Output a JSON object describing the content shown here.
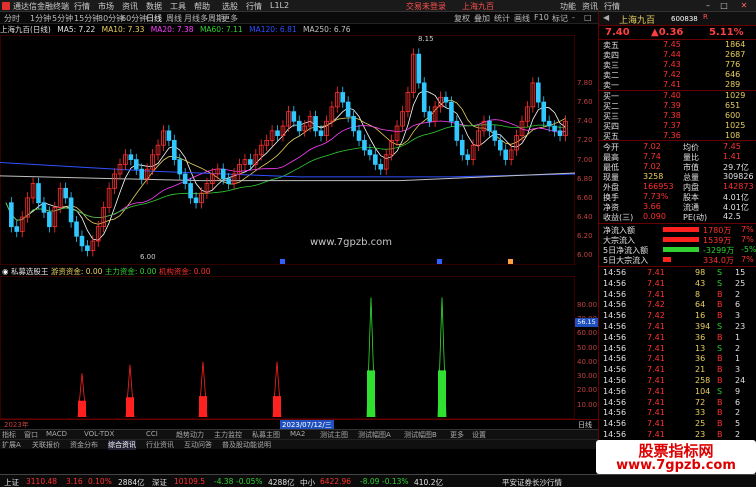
{
  "window": {
    "app_title": "通达信金融终端",
    "menus": [
      "行情",
      "市场",
      "资讯",
      "数据",
      "工具",
      "帮助",
      "选股",
      "行情",
      "L1L2"
    ],
    "center_notice": "交易未登录",
    "center_stock": "上海九百",
    "right_links": [
      "功能",
      "资讯",
      "行情"
    ]
  },
  "period_bar": {
    "periods": [
      "分时",
      "1分钟",
      "5分钟",
      "15分钟",
      "30分钟",
      "60分钟",
      "日线",
      "周线",
      "月线",
      "多周期",
      "更多"
    ],
    "active": "日线",
    "tools": [
      "复权",
      "叠加",
      "统计",
      "画线",
      "F10",
      "标记",
      "-",
      "□"
    ]
  },
  "info_line": {
    "title": "上海九百(日线)",
    "ma5": "MA5: 7.22",
    "ma10": "MA10: 7.33",
    "ma20": "MA20: 7.38",
    "ma60": "MA60: 7.11",
    "ma120": "MA120: 6.81",
    "ma250": "MA250: 6.76"
  },
  "main_chart": {
    "high_label": "8.15",
    "low_label": "6.00",
    "site_watermark": "www.7gpzb.com",
    "price_ticks": [
      "7.80",
      "7.60",
      "7.40",
      "7.20",
      "7.00",
      "6.80",
      "6.60",
      "6.40",
      "6.20",
      "6.00"
    ],
    "price_range": [
      5.9,
      8.3
    ],
    "colors": {
      "up": "#ff3030",
      "down": "#30c8ff",
      "ma5": "#ffffff",
      "ma10": "#e8d060",
      "ma20": "#ff40ff",
      "ma60": "#30d030",
      "ma120": "#3050ff",
      "ma250": "#c0c0c0"
    }
  },
  "indicator": {
    "name": "私募选股王",
    "fund_main": "游资资金: 0.00",
    "fund_force": "主力资金: 0.00",
    "fund_inst": "机构资金: 0.00",
    "ticks": [
      "80.00",
      "70.00",
      "60.00",
      "50.00",
      "40.00",
      "30.00",
      "20.00",
      "10.00"
    ],
    "marker_value": "56.15",
    "range": [
      0,
      100
    ]
  },
  "chart_data": {
    "type": "candlestick",
    "title": "上海九百(日线)",
    "ylim": [
      6.0,
      8.2
    ],
    "annotations": [
      {
        "label": "8.15",
        "kind": "high"
      },
      {
        "label": "6.00",
        "kind": "low"
      }
    ],
    "indicator_spikes": [
      {
        "index": 1,
        "value": 32,
        "color": "red"
      },
      {
        "index": 2,
        "value": 38,
        "color": "red"
      },
      {
        "index": 3,
        "value": 40,
        "color": "red"
      },
      {
        "index": 4,
        "value": 40,
        "color": "red"
      },
      {
        "index": 5,
        "value": 85,
        "color": "green"
      },
      {
        "index": 6,
        "value": 85,
        "color": "green"
      }
    ]
  },
  "date_axis": {
    "left_label": "2023年",
    "cursor_date": "2023/07/12/三",
    "right_label": "日线"
  },
  "tabs_row1": [
    "指标",
    "窗口",
    "MACD",
    "VOL-TDX",
    "CCI",
    "趋势动力",
    "主力监控",
    "私募主图",
    "MA2",
    "测试主图",
    "测试幅图A",
    "测试幅图B",
    "更多",
    "设置"
  ],
  "tabs_row2": [
    "扩展A",
    "关联报价",
    "资金分布",
    "综合资讯",
    "行业资讯",
    "互动问答",
    "普及股动能说明"
  ],
  "right_panel": {
    "name": "上海九百",
    "code": "600838",
    "flag": "R",
    "price": "7.40",
    "change": "▲0.36",
    "pct": "5.11%",
    "asks": [
      {
        "label": "卖五",
        "price": "7.45",
        "vol": "1864"
      },
      {
        "label": "卖四",
        "price": "7.44",
        "vol": "2687"
      },
      {
        "label": "卖三",
        "price": "7.43",
        "vol": "776"
      },
      {
        "label": "卖二",
        "price": "7.42",
        "vol": "646"
      },
      {
        "label": "卖一",
        "price": "7.41",
        "vol": "289"
      }
    ],
    "bids": [
      {
        "label": "买一",
        "price": "7.40",
        "vol": "1029"
      },
      {
        "label": "买二",
        "price": "7.39",
        "vol": "651"
      },
      {
        "label": "买三",
        "price": "7.38",
        "vol": "600"
      },
      {
        "label": "买四",
        "price": "7.37",
        "vol": "1025"
      },
      {
        "label": "买五",
        "price": "7.36",
        "vol": "108"
      }
    ],
    "stats": [
      {
        "l1": "今开",
        "v1": "7.02",
        "l2": "均价",
        "v2": "7.45"
      },
      {
        "l1": "最高",
        "v1": "7.74",
        "l2": "量比",
        "v2": "1.41"
      },
      {
        "l1": "最低",
        "v1": "7.02",
        "l2": "市值",
        "v2": "29.7亿"
      },
      {
        "l1": "现量",
        "v1": "3258",
        "l2": "总量",
        "v2": "309826"
      },
      {
        "l1": "外盘",
        "v1": "166953",
        "l2": "内盘",
        "v2": "142873"
      },
      {
        "l1": "换手",
        "v1": "7.73%",
        "l2": "股本",
        "v2": "4.01亿"
      },
      {
        "l1": "净资",
        "v1": "3.66",
        "l2": "流通",
        "v2": "4.01亿"
      },
      {
        "l1": "收益(三)",
        "v1": "0.090",
        "l2": "PE(动)",
        "v2": "42.5"
      }
    ],
    "flows": [
      {
        "label": "净流入额",
        "value": "1780万",
        "pct": "7%"
      },
      {
        "label": "大宗流入",
        "value": "1539万",
        "pct": "7%"
      },
      {
        "label": "5日净流入额",
        "value": "-3299万",
        "pct": "-5%"
      },
      {
        "label": "5日大宗流入",
        "value": "334.0万",
        "pct": "7%"
      }
    ],
    "ticks": [
      {
        "t": "14:56",
        "p": "7.41",
        "v": "98",
        "s": "S",
        "n": "15"
      },
      {
        "t": "14:56",
        "p": "7.41",
        "v": "43",
        "s": "S",
        "n": "25"
      },
      {
        "t": "14:56",
        "p": "7.41",
        "v": "8",
        "s": "B",
        "n": "2"
      },
      {
        "t": "14:56",
        "p": "7.42",
        "v": "64",
        "s": "B",
        "n": "6"
      },
      {
        "t": "14:56",
        "p": "7.42",
        "v": "16",
        "s": "B",
        "n": "3"
      },
      {
        "t": "14:56",
        "p": "7.41",
        "v": "394",
        "s": "S",
        "n": "23"
      },
      {
        "t": "14:56",
        "p": "7.41",
        "v": "36",
        "s": "B",
        "n": "1"
      },
      {
        "t": "14:56",
        "p": "7.41",
        "v": "13",
        "s": "S",
        "n": "2"
      },
      {
        "t": "14:56",
        "p": "7.41",
        "v": "36",
        "s": "B",
        "n": "1"
      },
      {
        "t": "14:56",
        "p": "7.41",
        "v": "21",
        "s": "B",
        "n": "3"
      },
      {
        "t": "14:56",
        "p": "7.41",
        "v": "258",
        "s": "B",
        "n": "24"
      },
      {
        "t": "14:56",
        "p": "7.41",
        "v": "104",
        "s": "S",
        "n": "9"
      },
      {
        "t": "14:56",
        "p": "7.41",
        "v": "72",
        "s": "B",
        "n": "6"
      },
      {
        "t": "14:56",
        "p": "7.41",
        "v": "33",
        "s": "B",
        "n": "2"
      },
      {
        "t": "14:56",
        "p": "7.41",
        "v": "25",
        "s": "B",
        "n": "5"
      },
      {
        "t": "14:56",
        "p": "7.41",
        "v": "23",
        "s": "B",
        "n": "2"
      }
    ]
  },
  "status_bar": {
    "sh_label": "上证",
    "sh_val": "3110.48",
    "sh_chg": "3.16",
    "sh_pct": "0.10%",
    "sh_amt": "2884亿",
    "sz_label": "深证",
    "sz_val": "10109.5",
    "sz_chg": "-4.38",
    "sz_pct": "-0.05%",
    "sz_amt": "4288亿",
    "zx_label": "中小",
    "zx_val": "6422.96",
    "zx_chg": "-8.09",
    "zx_pct": "-0.13%",
    "zx_amt": "410.2亿",
    "broker": "平安证券长沙行情"
  },
  "watermark": {
    "line1": "股票指标网",
    "line2": "www.7gpzb.com"
  }
}
